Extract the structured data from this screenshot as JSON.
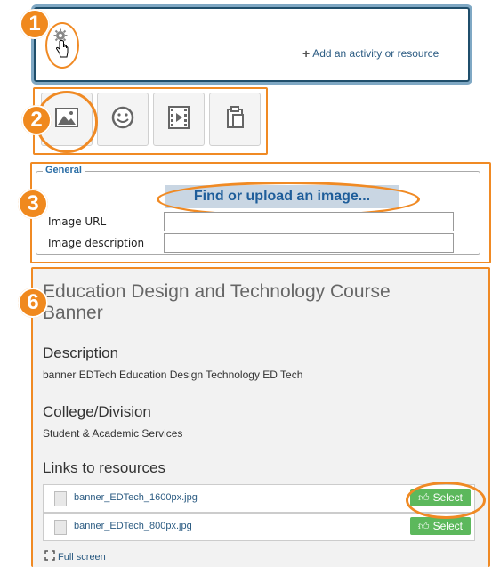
{
  "steps": [
    "1",
    "2",
    "3",
    "6"
  ],
  "panel1": {
    "add_label": "Add an activity or resource"
  },
  "toolbar": {
    "buttons": [
      "image-icon",
      "emoticon-icon",
      "media-icon",
      "paste-icon"
    ]
  },
  "form": {
    "legend": "General",
    "find_button": "Find or upload an image...",
    "image_url_label": "Image URL",
    "image_url_value": "",
    "image_desc_label": "Image description",
    "image_desc_value": ""
  },
  "resource": {
    "title": "Education Design and Technology Course Banner",
    "description_heading": "Description",
    "description_text": "banner EDTech Education Design Technology ED Tech",
    "college_heading": "College/Division",
    "college_text": "Student & Academic Services",
    "links_heading": "Links to resources",
    "links": [
      {
        "file": "banner_EDTech_1600px.jpg",
        "button": "Select"
      },
      {
        "file": "banner_EDTech_800px.jpg",
        "button": "Select"
      }
    ],
    "fullscreen_label": "Full screen"
  },
  "colors": {
    "accent": "#f08a24",
    "link": "#2b5b82",
    "select": "#5cb85c"
  }
}
